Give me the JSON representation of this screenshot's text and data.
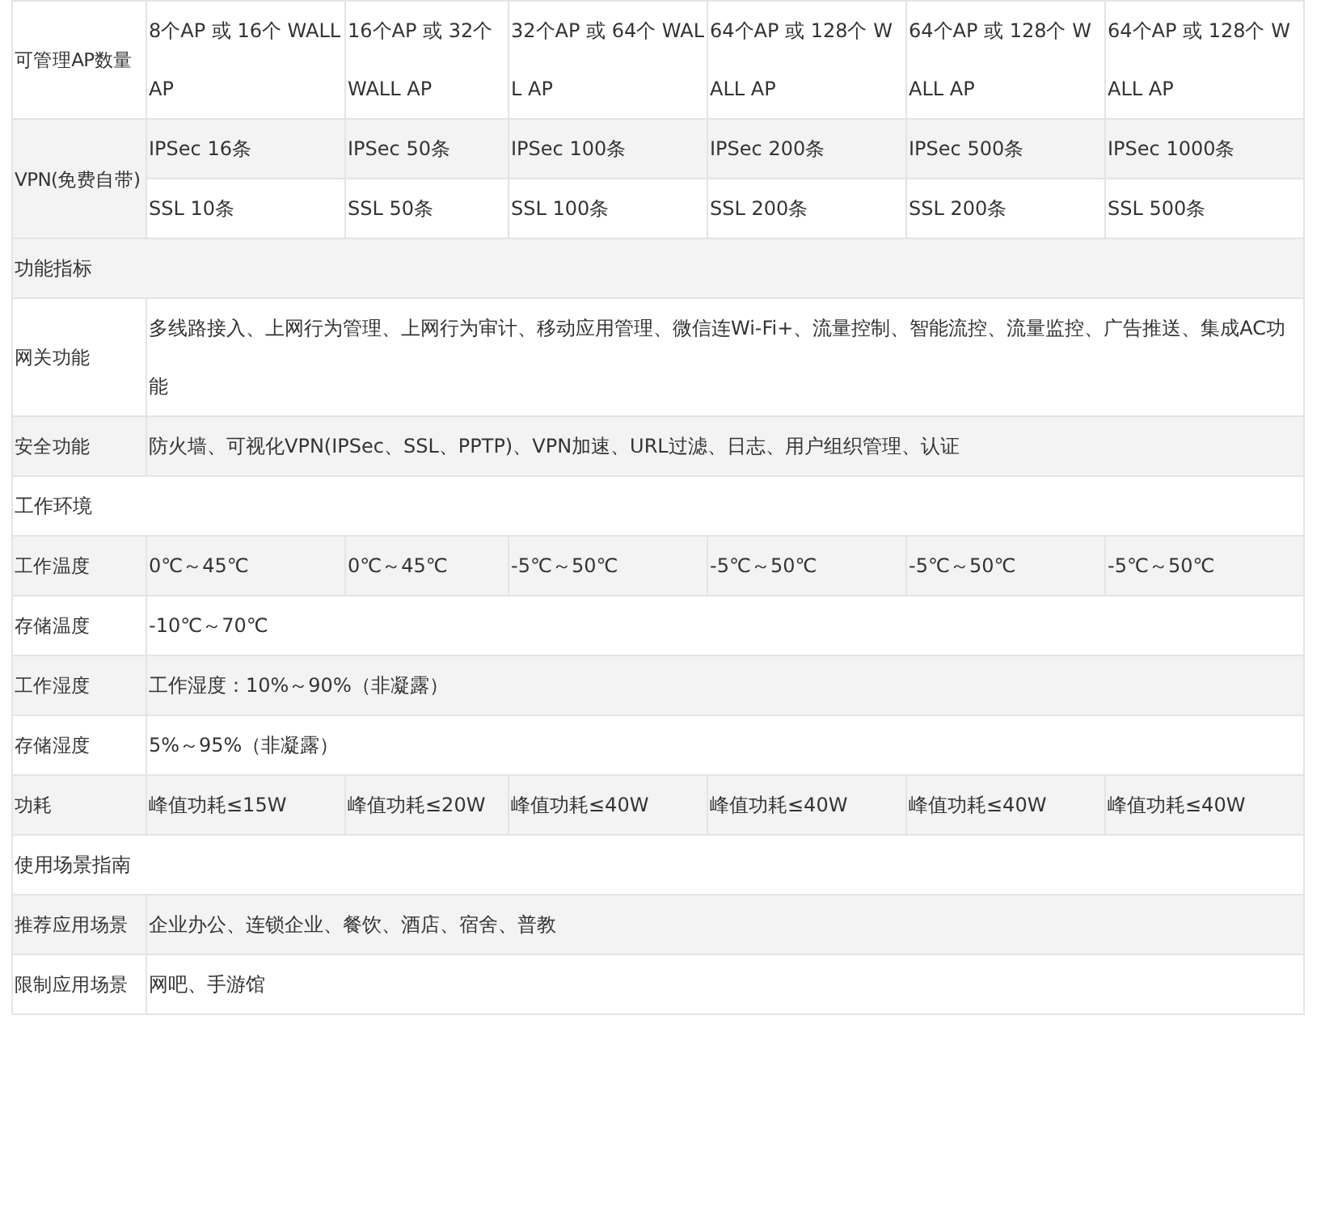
{
  "table": {
    "rows": [
      {
        "kind": "spec",
        "label": "可管理AP数量",
        "values": [
          "8个AP 或 16个 WALL AP",
          "16个AP 或 32个 WALL AP",
          "32个AP 或 64个 WALL AP",
          "64个AP 或 128个 WALL AP",
          "64个AP 或 128个 WALL AP",
          "64个AP 或 128个 WALL AP"
        ]
      },
      {
        "kind": "group",
        "label": "VPN(免费自带)",
        "sub_rows": [
          [
            "IPSec 16条",
            "IPSec 50条",
            "IPSec 100条",
            "IPSec 200条",
            "IPSec 500条",
            "IPSec 1000条"
          ],
          [
            "SSL 10条",
            "SSL 50条",
            "SSL 100条",
            "SSL 200条",
            "SSL 200条",
            "SSL 500条"
          ]
        ]
      },
      {
        "kind": "section",
        "label": "功能指标"
      },
      {
        "kind": "spec",
        "label": "网关功能",
        "values": [
          "多线路接入、上网行为管理、上网行为审计、移动应用管理、微信连Wi-Fi+、流量控制、智能流控、流量监控、广告推送、集成AC功能"
        ]
      },
      {
        "kind": "spec",
        "label": "安全功能",
        "values": [
          "防火墙、可视化VPN(IPSec、SSL、PPTP)、VPN加速、URL过滤、日志、用户组织管理、认证"
        ]
      },
      {
        "kind": "section",
        "label": "工作环境"
      },
      {
        "kind": "spec",
        "label": "工作温度",
        "values": [
          "0℃～45℃",
          "0℃～45℃",
          "-5℃～50℃",
          "-5℃～50℃",
          "-5℃～50℃",
          "-5℃～50℃"
        ]
      },
      {
        "kind": "spec",
        "label": "存储温度",
        "values": [
          "-10℃～70℃"
        ]
      },
      {
        "kind": "spec",
        "label": "工作湿度",
        "values": [
          "工作湿度：10%～90%（非凝露）"
        ]
      },
      {
        "kind": "spec",
        "label": "存储湿度",
        "values": [
          "5%～95%（非凝露）"
        ]
      },
      {
        "kind": "spec",
        "label": "功耗",
        "values": [
          "峰值功耗≤15W",
          "峰值功耗≤20W",
          "峰值功耗≤40W",
          "峰值功耗≤40W",
          "峰值功耗≤40W",
          "峰值功耗≤40W"
        ]
      },
      {
        "kind": "section",
        "label": "使用场景指南"
      },
      {
        "kind": "spec",
        "label": "推荐应用场景",
        "values": [
          "企业办公、连锁企业、餐饮、酒店、宿舍、普教"
        ]
      },
      {
        "kind": "spec",
        "label": "限制应用场景",
        "values": [
          "网吧、手游馆"
        ]
      }
    ]
  }
}
